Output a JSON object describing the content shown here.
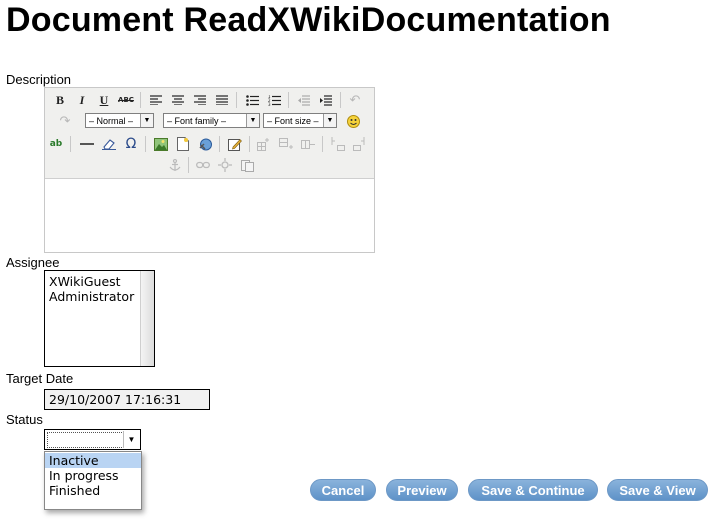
{
  "page_title": "Document ReadXWikiDocumentation",
  "description": {
    "label": "Description",
    "toolbar": {
      "bold": "B",
      "italic": "I",
      "underline": "U",
      "strike": "ABC",
      "format_select": "– Normal –",
      "font_family_select": "– Font family –",
      "font_size_select": "– Font size –",
      "spellcheck": "ab",
      "omega": "Ω"
    }
  },
  "assignee": {
    "label": "Assignee",
    "options": [
      "XWikiGuest",
      "Administrator"
    ]
  },
  "target_date": {
    "label": "Target Date",
    "value": "29/10/2007 17:16:31"
  },
  "status": {
    "label": "Status",
    "options": [
      "Inactive",
      "In progress",
      "Finished"
    ],
    "highlighted": "Inactive"
  },
  "buttons": {
    "cancel": "Cancel",
    "preview": "Preview",
    "save_continue": "Save & Continue",
    "save_view": "Save & View"
  },
  "colors": {
    "button": "#6b9bd0",
    "highlight": "#b9d4f3",
    "toolbar_bg": "#f0f0ee"
  }
}
